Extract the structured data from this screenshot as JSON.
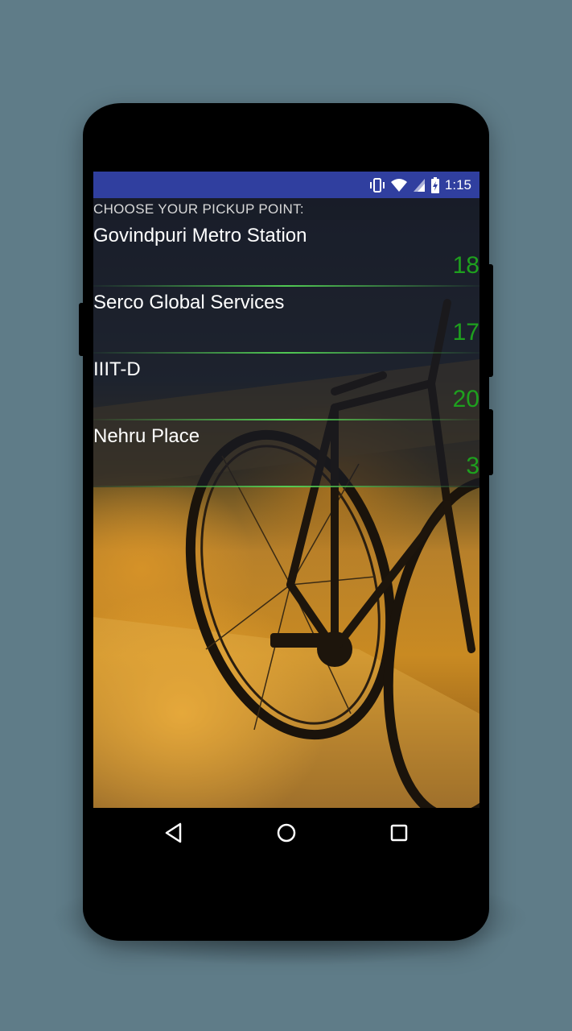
{
  "status_bar": {
    "time": "1:15",
    "icons": [
      "vibrate-icon",
      "wifi-icon",
      "signal-icon",
      "battery-charging-icon"
    ],
    "color": "#303f9f"
  },
  "screen": {
    "header": "CHOOSE YOUR PICKUP POINT:",
    "pickup_points": [
      {
        "name": "Govindpuri Metro Station",
        "count": "18"
      },
      {
        "name": "Serco Global Services",
        "count": "17"
      },
      {
        "name": "IIIT-D",
        "count": "20"
      },
      {
        "name": "Nehru Place",
        "count": "3"
      }
    ],
    "count_color": "#1ea01e"
  },
  "nav_bar": {
    "buttons": [
      "back-icon",
      "home-icon",
      "recents-icon"
    ]
  }
}
